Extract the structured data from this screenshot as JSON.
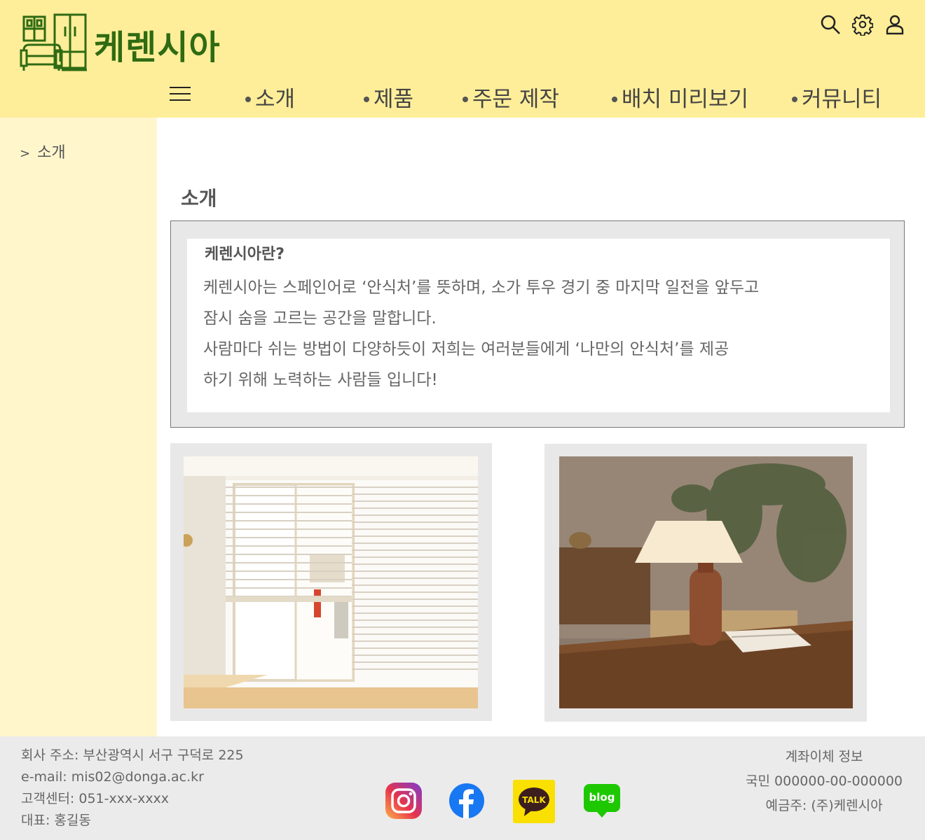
{
  "header": {
    "brand": "케렌시아",
    "nav": [
      {
        "label": "소개"
      },
      {
        "label": "제품"
      },
      {
        "label": "주문 제작"
      },
      {
        "label": "배치 미리보기"
      },
      {
        "label": "커뮤니티"
      }
    ],
    "icons": [
      "search-icon",
      "gear-icon",
      "user-icon",
      "menu-icon"
    ]
  },
  "sidebar": {
    "breadcrumb_marker": ">",
    "breadcrumb_label": "소개"
  },
  "main": {
    "title": "소개",
    "about": {
      "heading": "케렌시아란?",
      "lines": [
        "케렌시아는 스페인어로 ‘안식처’를 뜻하며, 소가 투우 경기 중 마지막 일전을 앞두고",
        "잠시 숨을 고르는 공간을 말합니다.",
        "사람마다 쉬는 방법이 다양하듯이 저희는 여러분들에게 ‘나만의 안식처’를 제공",
        "하기 위해  노력하는 사람들 입니다!"
      ]
    },
    "photos": [
      "window-blinds-photo",
      "table-lamp-photo"
    ]
  },
  "footer": {
    "address": "회사 주소: 부산광역시 서구 구덕로 225",
    "email": "e-mail: mis02@donga.ac.kr",
    "support": "고객센터: 051-xxx-xxxx",
    "ceo": "대표: 홍길동",
    "bank_title": "계좌이체 정보",
    "bank_account": "국민 000000-00-000000",
    "bank_holder": "예금주: (주)케렌시아",
    "social": {
      "talk_label": "TALK",
      "blog_label": "blog"
    }
  },
  "colors": {
    "header_bg": "#ffee99",
    "sidebar_bg": "#fff6cc",
    "brand_green": "#2f6b12",
    "footer_bg": "#ebebeb"
  }
}
